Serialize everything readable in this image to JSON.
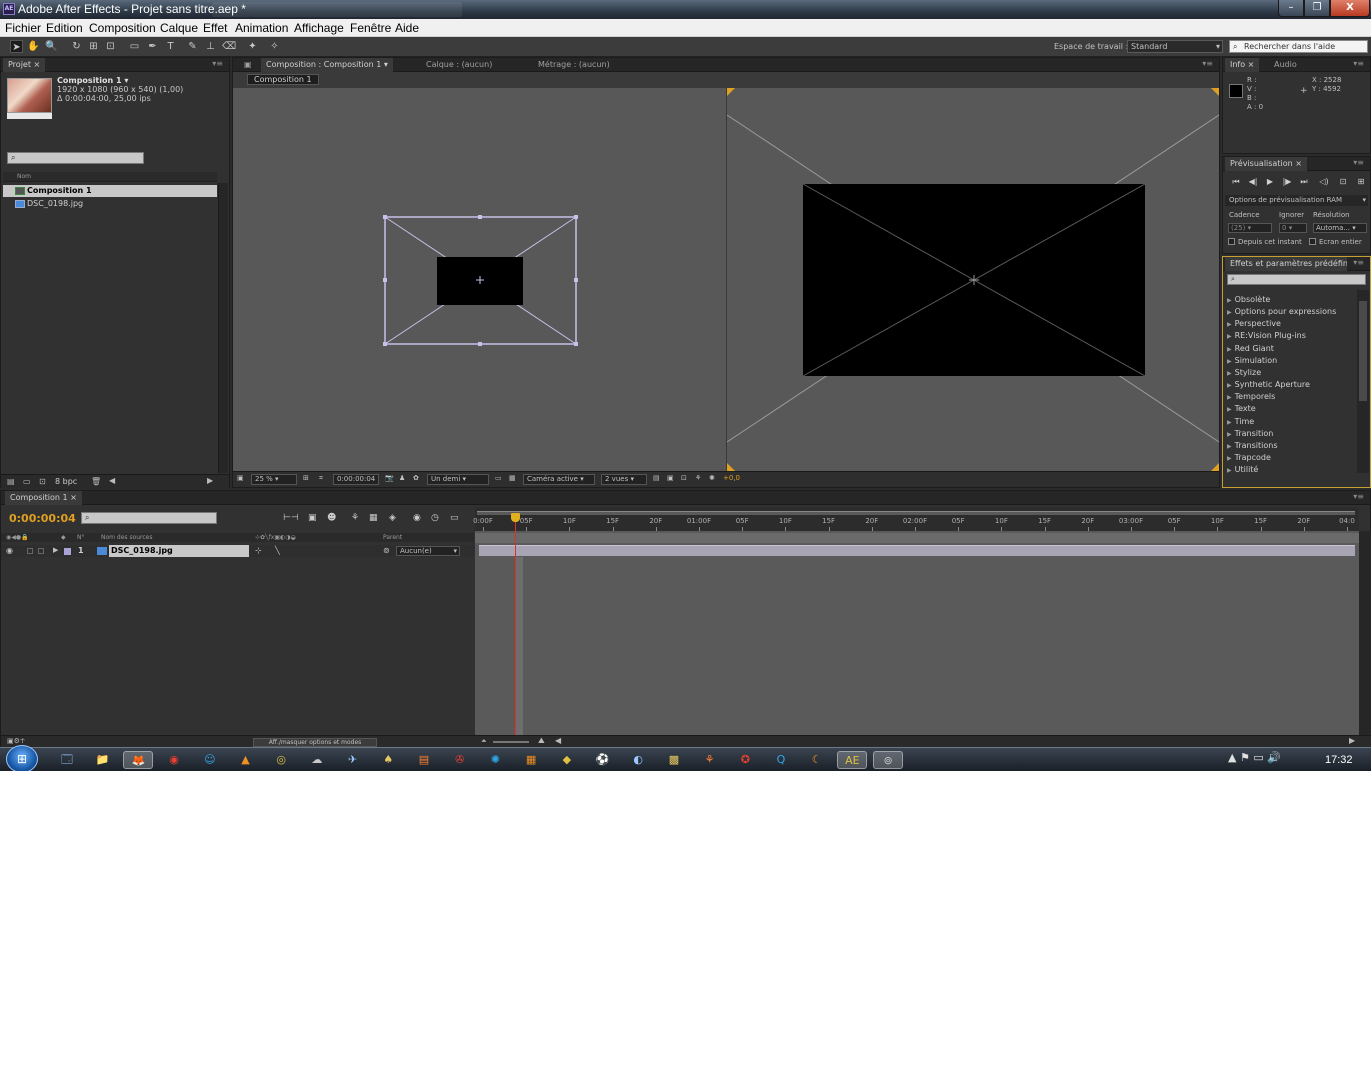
{
  "window": {
    "title": "Adobe After Effects - Projet sans titre.aep *",
    "icon_text": "AE",
    "controls": {
      "minimize": "–",
      "maximize": "❐",
      "close": "X"
    }
  },
  "menu": [
    "Fichier",
    "Edition",
    "Composition",
    "Calque",
    "Effet",
    "Animation",
    "Affichage",
    "Fenêtre",
    "Aide"
  ],
  "toolbar": {
    "tools": [
      "➤",
      "✋",
      "🔍",
      "↻",
      "⊞",
      "⊡",
      "▭",
      "✒",
      "T",
      "✎",
      "⊥",
      "⌫",
      "✦",
      "✧"
    ],
    "workspace_label": "Espace de travail :",
    "workspace_value": "Standard",
    "help_search": "Rechercher dans l'aide"
  },
  "project": {
    "tab": "Projet ×",
    "comp_name": "Composition 1 ▾",
    "info_line1": "1920 x 1080  (960 x 540) (1,00)",
    "info_line2": "Δ 0:00:04:00, 25,00 ips",
    "search_placeholder": "⌕",
    "col_name": "Nom",
    "items": [
      "Composition 1",
      "DSC_0198.jpg"
    ],
    "bpc": "8 bpc"
  },
  "composition": {
    "tabs": [
      "Composition : Composition 1 ▾",
      "Calque : (aucun)",
      "Métrage : (aucun)"
    ],
    "subtab": "Composition 1",
    "footer": {
      "zoom": "25 %",
      "timecode": "0:00:00:04",
      "resolution": "Un demi",
      "camera": "Caméra active",
      "views": "2 vues",
      "exposure": "+0,0"
    }
  },
  "info": {
    "tabs": [
      "Info ×",
      "Audio"
    ],
    "r": "R :",
    "v": "V :",
    "b": "B :",
    "a": "A : 0",
    "x": "X : 2528",
    "y": "Y : 4592"
  },
  "preview": {
    "tab": "Prévisualisation ×",
    "buttons": [
      "⏮",
      "◀|",
      "▶",
      "|▶",
      "⏭",
      "◁)",
      "⊡",
      "⊞"
    ],
    "ram_options": "Options de prévisualisation RAM",
    "cadence_label": "Cadence",
    "ignorer_label": "Ignorer",
    "resolution_label": "Résolution",
    "cadence_value": "(25)",
    "ignorer_value": "0",
    "resolution_value": "Automa...",
    "depuis": "Depuis cet instant",
    "ecran": "Ecran entier"
  },
  "effects": {
    "tab": "Effets et paramètres prédéfinis",
    "search_placeholder": "⌕",
    "items": [
      "Obsolète",
      "Options pour expressions",
      "Perspective",
      "RE:Vision Plug-ins",
      "Red Giant",
      "Simulation",
      "Stylize",
      "Synthetic Aperture",
      "Temporels",
      "Texte",
      "Time",
      "Transition",
      "Transitions",
      "Trapcode",
      "Utilité"
    ]
  },
  "timeline": {
    "tab": "Composition 1 ×",
    "current_time": "0:00:00:04",
    "search_placeholder": "⌕",
    "col_num": "N°",
    "col_source": "Nom des sources",
    "col_parent": "Parent",
    "layer": {
      "number": "1",
      "name": "DSC_0198.jpg",
      "parent": "Aucun(e)"
    },
    "ruler": [
      "0:00F",
      "05F",
      "10F",
      "15F",
      "20F",
      "01:00F",
      "05F",
      "10F",
      "15F",
      "20F",
      "02:00F",
      "05F",
      "10F",
      "15F",
      "20F",
      "03:00F",
      "05F",
      "10F",
      "15F",
      "20F",
      "04:0"
    ],
    "toggle_label": "Aff./masquer options et modes"
  },
  "taskbar": {
    "start": "⊞",
    "apps": [
      "🗔",
      "📁",
      "🦊",
      "◉",
      "☺",
      "▲",
      "◎",
      "☁",
      "✈",
      "♠",
      "▤",
      "✇",
      "✺",
      "▦",
      "◆",
      "⚽",
      "◐",
      "▩",
      "⚘",
      "✪",
      "Q",
      "☾",
      "AE",
      "⊚"
    ],
    "tray": "▲  ⚑  ▭  🔊",
    "clock": "17:32"
  }
}
